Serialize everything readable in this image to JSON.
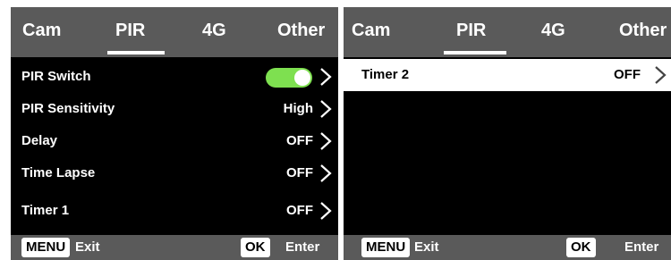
{
  "left": {
    "tabs": [
      "Cam",
      "PIR",
      "4G",
      "Other"
    ],
    "active_tab": "PIR",
    "rows": [
      {
        "label": "PIR Switch",
        "value": "",
        "toggle": true,
        "toggle_on": true
      },
      {
        "label": "PIR Sensitivity",
        "value": "High"
      },
      {
        "label": "Delay",
        "value": "OFF"
      },
      {
        "label": "Time Lapse",
        "value": "OFF"
      },
      {
        "label": "Timer 1",
        "value": "OFF"
      }
    ],
    "footer": {
      "menu_key": "MENU",
      "menu_text": "Exit",
      "ok_key": "OK",
      "ok_text": "Enter"
    }
  },
  "right": {
    "tabs": [
      "Cam",
      "PIR",
      "4G",
      "Other"
    ],
    "active_tab": "PIR",
    "rows": [
      {
        "label": "Timer 2",
        "value": "OFF",
        "selected": true
      }
    ],
    "footer": {
      "menu_key": "MENU",
      "menu_text": "Exit",
      "ok_key": "OK",
      "ok_text": "Enter"
    }
  },
  "colors": {
    "tabbar_bg": "#5a5a5a",
    "screen_bg": "#000000",
    "toggle_on": "#7ee050",
    "selected_row_bg": "#ffffff"
  }
}
